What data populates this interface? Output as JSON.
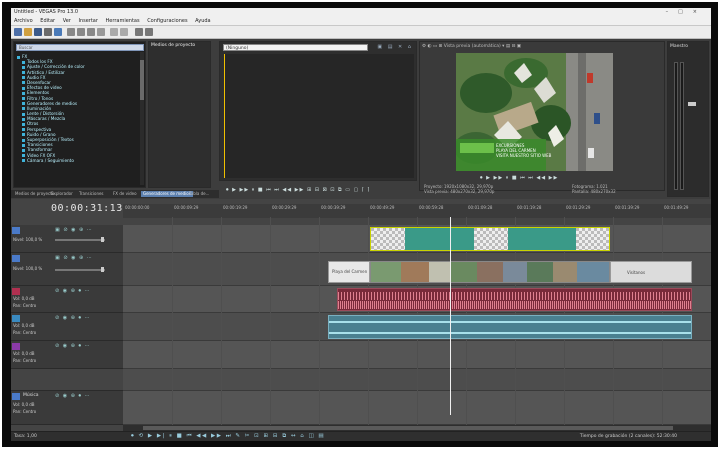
{
  "window": {
    "title": "Untitled - VEGAS Pro 13.0",
    "controls": [
      "–",
      "□",
      "×"
    ]
  },
  "menu": [
    "Archivo",
    "Editar",
    "Ver",
    "Insertar",
    "Herramientas",
    "Configuraciones",
    "Ayuda"
  ],
  "explorer": {
    "search_placeholder": "Buscar",
    "root": "FX",
    "items": [
      "Todos los FX",
      "Ajuste / Corrección de color",
      "Artístico / Estilizar",
      "Audio FX",
      "Desenfocar",
      "Efectos de video",
      "Elementos",
      "Filtro / Tonos",
      "Generadores de medios",
      "Iluminación",
      "Lente / Distorsión",
      "Máscaras / Mezcla",
      "Otros",
      "Perspectiva",
      "Ruido / Grano",
      "Superposición / Textos",
      "Transiciones",
      "Transformar",
      "Video FX OFX",
      "Cámara / Seguimiento"
    ]
  },
  "media_pane": {
    "header": "Medios de proyecto"
  },
  "timeline_pane": {
    "combo": "(Ninguno)"
  },
  "pane_tabs": [
    "Medios de proyecto",
    "Explorador",
    "Transiciones",
    "FX de video",
    "Generadores de medios",
    "Tabla de..."
  ],
  "preview": {
    "toolbar": "Vista previa (automática) ▾",
    "project_info": "Proyecto: 1920x1080x32, 29,970p",
    "preview_info": "Vista previa: 480x270x32, 29,970p",
    "frame_info": "Fotograma: 1.021",
    "display_info": "Pantalla: 480x270x32",
    "overlay_lines": [
      "EXCURSIONES",
      "PLAYA DEL CARMEN",
      "VISITA NUESTRO SITIO WEB"
    ]
  },
  "master": {
    "header": "Maestro"
  },
  "timeline": {
    "timecode": "00:00:31:13",
    "ruler_labels": [
      "00:00:00:00",
      "00:00:09:29",
      "00:00:19:29",
      "00:00:29:29",
      "00:00:39:29",
      "00:00:49:29",
      "00:00:59:28",
      "00:01:09:28",
      "00:01:19:28",
      "00:01:29:29",
      "00:01:39:29",
      "00:01:49:29"
    ],
    "tracks": [
      {
        "number": "1",
        "kind": "video",
        "level_label": "Nivel:",
        "level_value": "100,0 %"
      },
      {
        "number": "2",
        "kind": "video",
        "level_label": "Nivel:",
        "level_value": "100,0 %"
      },
      {
        "number": "3",
        "kind": "audio",
        "vol_label": "Vol:",
        "vol_value": "0,0 dB",
        "pan_label": "Pan:",
        "pan_value": "Centro"
      },
      {
        "number": "4",
        "kind": "audio",
        "vol_label": "Vol:",
        "vol_value": "0,0 dB",
        "pan_label": "Pan:",
        "pan_value": "Centro"
      },
      {
        "number": "5",
        "kind": "audio",
        "vol_label": "Vol:",
        "vol_value": "0,0 dB",
        "pan_label": "Pan:",
        "pan_value": "Centro"
      },
      {
        "number": "6",
        "kind": "audio",
        "name": "Música",
        "vol_label": "Vol:",
        "vol_value": "0,0 dB",
        "pan_label": "Pan:",
        "pan_value": "Centro"
      }
    ],
    "clip_text": {
      "intro_title": "Playa del Carmen",
      "end_title": "Visítanos"
    }
  },
  "status": {
    "rate": "Tasa: 1,00",
    "record_time": "Tiempo de grabación (2 canales): 52:30:40"
  },
  "colors": {
    "accent_yellow": "#c9d300",
    "audio_red": "#7a2a3a",
    "audio_teal": "#5a9aaa",
    "track_teal": "#3aa090",
    "selection_blue": "#5b7fae"
  }
}
